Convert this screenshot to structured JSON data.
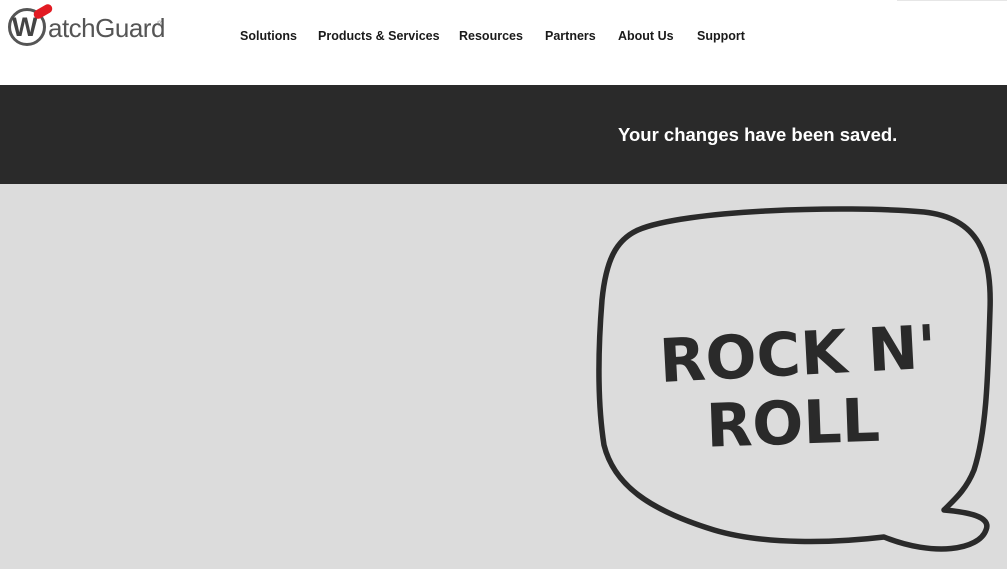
{
  "header": {
    "brand": "WatchGuard",
    "brand_initial": "W",
    "brand_rest": "atchGuard",
    "registered_mark": "®",
    "nav": [
      {
        "label": "Solutions"
      },
      {
        "label": "Products & Services"
      },
      {
        "label": "Resources"
      },
      {
        "label": "Partners"
      },
      {
        "label": "About Us"
      },
      {
        "label": "Support"
      }
    ]
  },
  "banner": {
    "message": "Your changes have been saved."
  },
  "hero": {
    "bubble_line1": "ROCK N'",
    "bubble_line2": "ROLL"
  },
  "colors": {
    "brand_red": "#e21b23",
    "banner_bg": "#2a2a2a",
    "content_bg": "#dcdcdc",
    "ink": "#2a2a2a"
  }
}
